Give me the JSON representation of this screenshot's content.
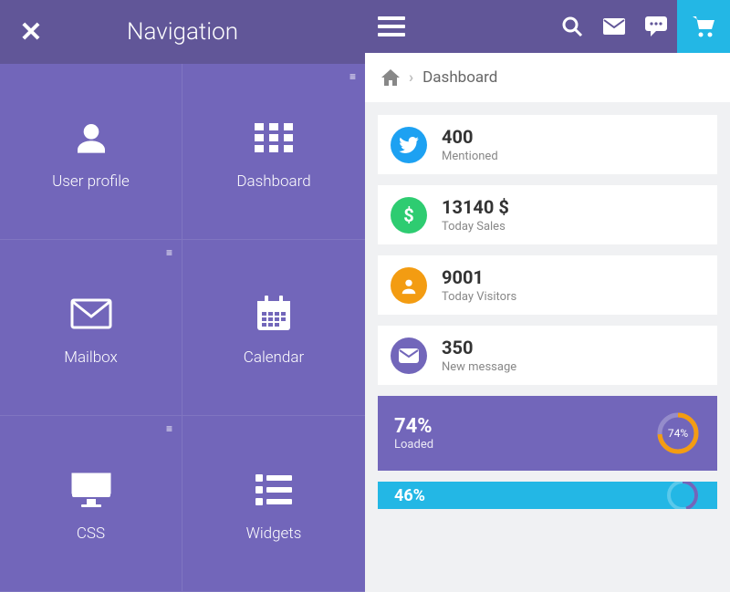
{
  "nav": {
    "title": "Navigation",
    "tiles": [
      {
        "label": "User profile"
      },
      {
        "label": "Dashboard"
      },
      {
        "label": "Mailbox"
      },
      {
        "label": "Calendar"
      },
      {
        "label": "CSS"
      },
      {
        "label": "Widgets"
      }
    ]
  },
  "breadcrumb": {
    "current": "Dashboard"
  },
  "stats": [
    {
      "value": "400",
      "label": "Mentioned"
    },
    {
      "value": "13140 $",
      "label": "Today Sales"
    },
    {
      "value": "9001",
      "label": "Today Visitors"
    },
    {
      "value": "350",
      "label": "New message"
    }
  ],
  "progress": {
    "percent": "74%",
    "label": "Loaded",
    "pct_small": "74%"
  },
  "progress2": {
    "percent": "46%"
  }
}
